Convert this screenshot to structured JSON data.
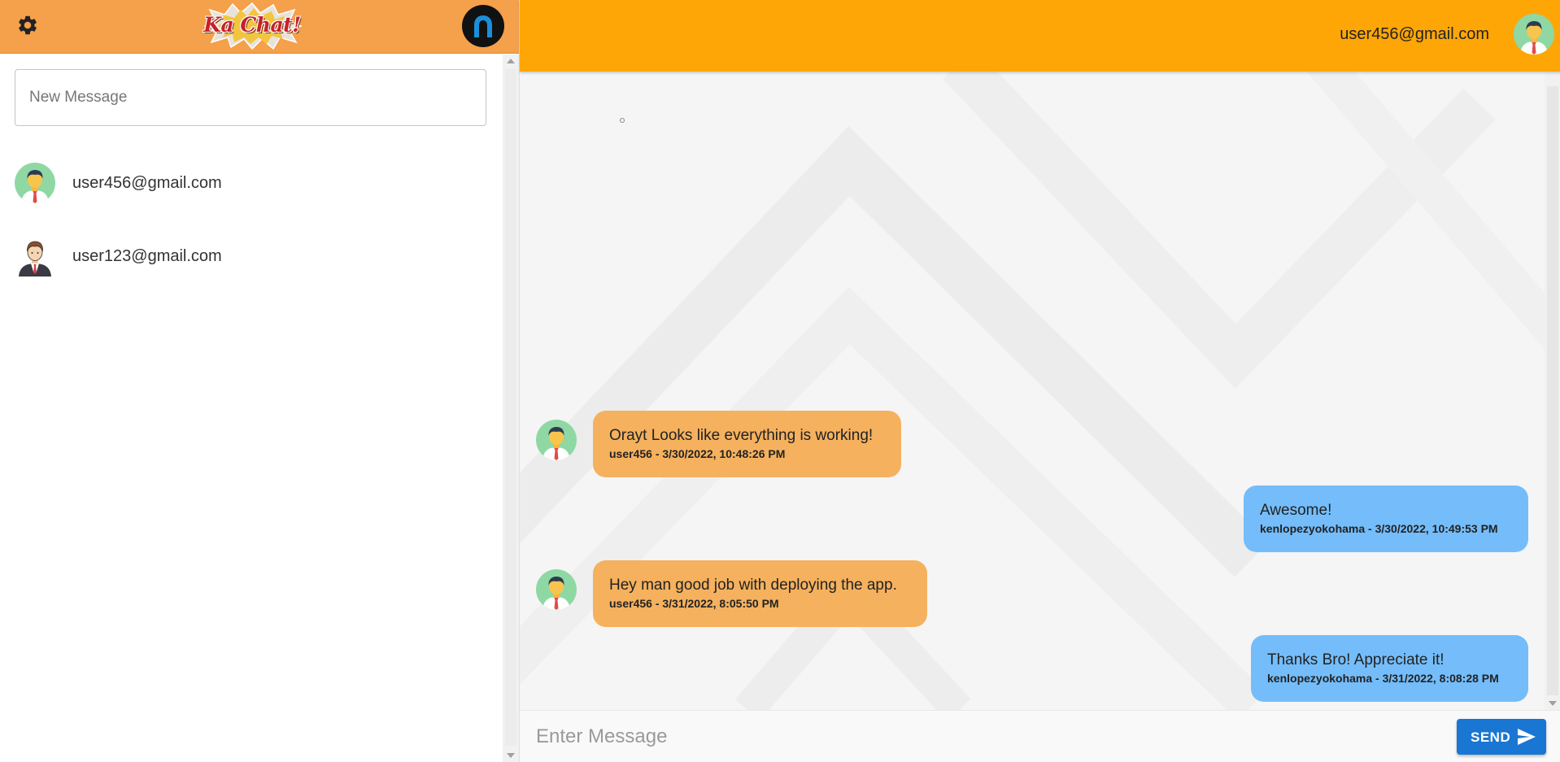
{
  "app": {
    "logo_text": "Ka Chat!",
    "colors": {
      "left_header": "#f5a04a",
      "right_header": "#ffa607",
      "incoming_bubble": "#f5b15e",
      "outgoing_bubble": "#74bdfa",
      "send_button": "#1976d2"
    }
  },
  "sidebar": {
    "settings_icon": "gear-icon",
    "profile_icon": "user-circle-icon",
    "new_message_placeholder": "New Message",
    "contacts": [
      {
        "email": "user456@gmail.com",
        "avatar": "green-avatar"
      },
      {
        "email": "user123@gmail.com",
        "avatar": "brown-hair-avatar"
      }
    ]
  },
  "chat": {
    "header_email": "user456@gmail.com",
    "messages": [
      {
        "direction": "incoming",
        "text": "Orayt Looks like everything is working!",
        "meta": "user456 - 3/30/2022, 10:48:26 PM"
      },
      {
        "direction": "outgoing",
        "text": "Awesome!",
        "meta": "kenlopezyokohama - 3/30/2022, 10:49:53 PM"
      },
      {
        "direction": "incoming",
        "text": "Hey man good job with deploying the app.",
        "meta": "user456 - 3/31/2022, 8:05:50 PM"
      },
      {
        "direction": "outgoing",
        "text": "Thanks Bro! Appreciate it!",
        "meta": "kenlopezyokohama - 3/31/2022, 8:08:28 PM"
      }
    ],
    "input_placeholder": "Enter Message",
    "send_label": "SEND"
  }
}
